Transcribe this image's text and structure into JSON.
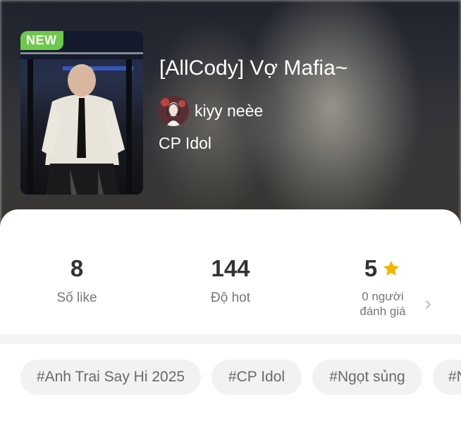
{
  "story": {
    "badge": "NEW",
    "title": "[AllCody] Vợ Mafia~",
    "author": "kiyy neèe",
    "category": "CP Idol"
  },
  "stats": {
    "likes": {
      "value": "8",
      "label": "Số like"
    },
    "hot": {
      "value": "144",
      "label": "Độ hot"
    },
    "rating": {
      "value": "5",
      "label_line1": "0 người",
      "label_line2": "đánh giá",
      "icon": "star-icon",
      "icon_color": "#f5b400"
    }
  },
  "tags": [
    "#Anh Trai Say Hi 2025",
    "#CP Idol",
    "#Ngọt sủng",
    "#N"
  ],
  "colors": {
    "badge_bg": "#6cc94a",
    "tag_bg": "#f2f2f2",
    "stat_value": "#333333",
    "stat_label": "#777777"
  }
}
